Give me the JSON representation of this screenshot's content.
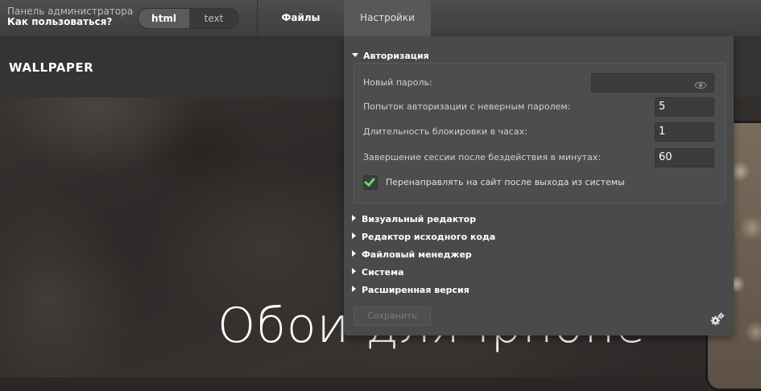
{
  "topbar": {
    "admin_title": "Панель администратора",
    "help_link": "Как пользоваться?",
    "mode_html": "html",
    "mode_text": "text",
    "nav_files": "Файлы",
    "nav_settings": "Настройки"
  },
  "site": {
    "logo": "WALLPAPER",
    "hero_title": "Обои для iphone"
  },
  "settings": {
    "auth_section": "Авторизация",
    "new_password_label": "Новый пароль:",
    "new_password_value": "",
    "attempts_label": "Попыток авторизации с неверным паролем:",
    "attempts_value": "5",
    "lock_hours_label": "Длительность блокировки в часах:",
    "lock_hours_value": "1",
    "session_label": "Завершение сессии после бездействия в минутах:",
    "session_value": "60",
    "redirect_label": "Перенаправлять на сайт после выхода из системы",
    "redirect_checked": true,
    "sections": [
      "Визуальный редактор",
      "Редактор исходного кода",
      "Файловый менеджер",
      "Система",
      "Расширенная версия"
    ],
    "save_label": "Сохранить"
  },
  "colors": {
    "panel_bg": "#4a4a4a",
    "topbar_bg": "#454545",
    "check_green": "#6ad66a"
  },
  "icons": [
    "eye-icon",
    "check-icon",
    "gears-icon",
    "triangle-down-icon",
    "triangle-right-icon"
  ]
}
